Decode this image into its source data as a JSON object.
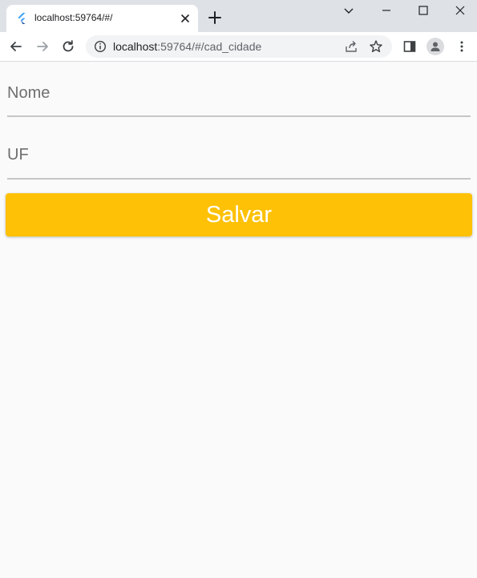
{
  "browser": {
    "tab": {
      "title": "localhost:59764/#/",
      "favicon": "flutter-icon"
    },
    "address": {
      "host": "localhost",
      "path": ":59764/#/cad_cidade"
    }
  },
  "form": {
    "nome_label": "Nome",
    "uf_label": "UF",
    "save_label": "Salvar"
  },
  "colors": {
    "accent": "#fec106",
    "button_text": "#ffffff",
    "background": "#fafafa"
  }
}
